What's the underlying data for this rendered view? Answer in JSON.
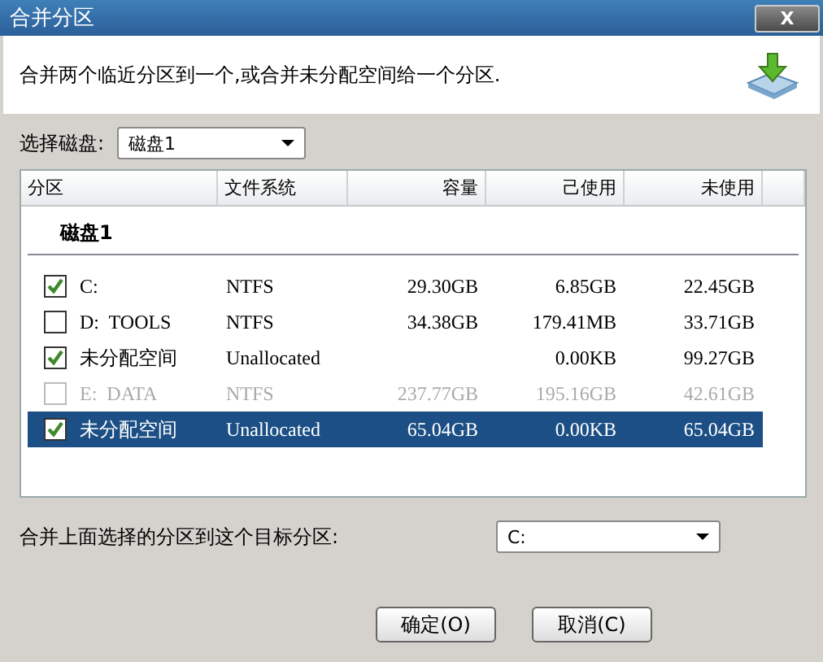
{
  "window": {
    "title": "合并分区",
    "close": "X"
  },
  "header": {
    "description": "合并两个临近分区到一个,或合并未分配空间给一个分区."
  },
  "disk_select": {
    "label": "选择磁盘:",
    "value": "磁盘1"
  },
  "table": {
    "columns": [
      "分区",
      "文件系统",
      "容量",
      "己使用",
      "未使用"
    ],
    "group": "磁盘1",
    "rows": [
      {
        "partition": "C:",
        "filesystem": "NTFS",
        "capacity": "29.30GB",
        "used": "6.85GB",
        "free": "22.45GB",
        "checked": true,
        "disabled": false,
        "selected": false
      },
      {
        "partition": "D:  TOOLS",
        "filesystem": "NTFS",
        "capacity": "34.38GB",
        "used": "179.41MB",
        "free": "33.71GB",
        "checked": false,
        "disabled": false,
        "selected": false
      },
      {
        "partition": "未分配空间",
        "filesystem": "Unallocated",
        "capacity": "",
        "used": "0.00KB",
        "free": "99.27GB",
        "checked": true,
        "disabled": false,
        "selected": false
      },
      {
        "partition": "E:  DATA",
        "filesystem": "NTFS",
        "capacity": "237.77GB",
        "used": "195.16GB",
        "free": "42.61GB",
        "checked": false,
        "disabled": true,
        "selected": false
      },
      {
        "partition": "未分配空间",
        "filesystem": "Unallocated",
        "capacity": "65.04GB",
        "used": "0.00KB",
        "free": "65.04GB",
        "checked": true,
        "disabled": false,
        "selected": true
      }
    ]
  },
  "target": {
    "label": "合并上面选择的分区到这个目标分区:",
    "value": "C:"
  },
  "buttons": [
    "确定(O)",
    "取消(C)"
  ]
}
